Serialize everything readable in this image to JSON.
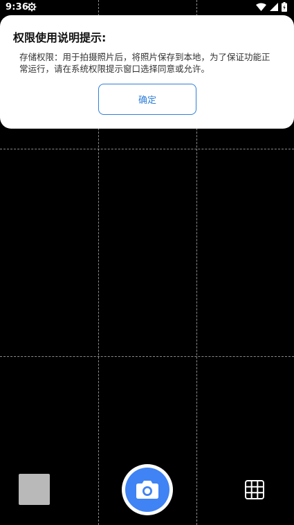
{
  "status_bar": {
    "time": "9:36",
    "icons": [
      "settings-icon",
      "wifi-icon",
      "signal-icon",
      "battery-charging-icon"
    ]
  },
  "dialog": {
    "title": "权限使用说明提示:",
    "message": "存储权限：用于拍摄照片后，将照片保存到本地，为了保证功能正常运行，请在系统权限提示窗口选择同意或允许。",
    "confirm_label": "确定"
  },
  "camera": {
    "shutter_icon": "camera-icon",
    "grid_icon": "grid-icon",
    "gallery_thumbnail": "gallery-thumbnail",
    "colors": {
      "shutter_blue": "#3f83f4",
      "button_blue": "#2f7fd8",
      "thumbnail_gray": "#b9b9b9"
    }
  }
}
